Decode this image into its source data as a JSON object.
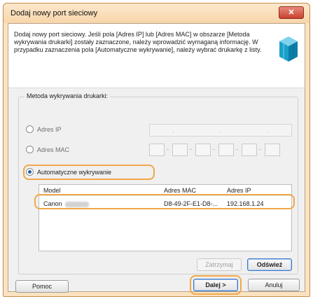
{
  "window": {
    "title": "Dodaj nowy port sieciowy",
    "close_label": "✕"
  },
  "header": {
    "description": "Dodaj nowy port sieciowy. Jeśli pola [Adres IP] lub [Adres MAC] w obszarze [Metoda wykrywania drukarki] zostały zaznaczone, należy wprowadzić wymaganą informację. W przypadku zaznaczenia pola [Automatyczne wykrywanie], należy wybrać drukarkę z listy."
  },
  "detection": {
    "group_label": "Metoda wykrywania drukarki:",
    "ip_label": "Adres IP",
    "mac_label": "Adres MAC",
    "auto_label": "Automatyczne wykrywanie",
    "ip_dots": [
      ".",
      ".",
      "."
    ],
    "mac_seps": [
      "-",
      "-",
      "-",
      "-",
      "-"
    ]
  },
  "list": {
    "columns": [
      "Model",
      "Adres MAC",
      "Adres IP"
    ],
    "rows": [
      {
        "model": "Canon",
        "mac": "D8-49-2F-E1-D8-...",
        "ip": "192.168.1.24"
      }
    ]
  },
  "buttons": {
    "refresh": "Zatrzymaj",
    "search": "Odśwież",
    "help": "Pomoc",
    "next": "Dalej >",
    "cancel": "Anuluj"
  }
}
